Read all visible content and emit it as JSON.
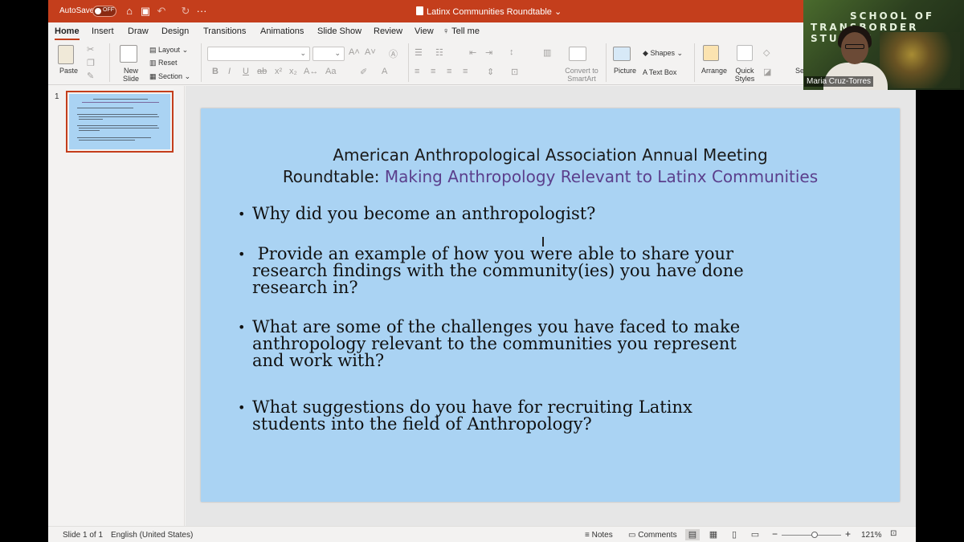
{
  "titlebar": {
    "autosave_label": "AutoSave",
    "autosave_state": "OFF",
    "doc_title": "Latinx Communities Roundtable",
    "title_chevron": "⌄",
    "more": "···"
  },
  "menu": {
    "tabs": [
      "Home",
      "Insert",
      "Draw",
      "Design",
      "Transitions",
      "Animations",
      "Slide Show",
      "Review",
      "View"
    ],
    "tell_me": "Tell me",
    "active": "Home"
  },
  "ribbon": {
    "paste": "Paste",
    "new_slide": "New Slide",
    "layout": "Layout",
    "reset": "Reset",
    "section": "Section",
    "convert_smartart": "Convert to SmartArt",
    "picture": "Picture",
    "shapes": "Shapes",
    "text_box": "Text Box",
    "arrange": "Arrange",
    "quick_styles": "Quick Styles",
    "cut_off": "Se"
  },
  "thumbnails": {
    "slide_number": "1"
  },
  "slide": {
    "title_line1": "American Anthropological Association Annual Meeting",
    "title_line2_prefix": "Roundtable: ",
    "title_line2_accent": "Making Anthropology Relevant to Latinx Communities",
    "bullets": [
      {
        "lines": [
          "Why did you become an anthropologist?"
        ]
      },
      {
        "lines": [
          " Provide an example of how you were able to share your",
          "research findings with the community(ies) you have done",
          "research in?"
        ]
      },
      {
        "lines": [
          "What are some of the challenges you have faced to make",
          "anthropology relevant to the communities you represent",
          "and work with?"
        ]
      },
      {
        "lines": [
          "What suggestions do you have for recruiting Latinx",
          "students into the field of Anthropology?"
        ]
      }
    ]
  },
  "statusbar": {
    "slide_info": "Slide 1 of 1",
    "language": "English (United States)",
    "notes": "Notes",
    "comments": "Comments",
    "zoom_minus": "−",
    "zoom_plus": "+",
    "zoom": "121%"
  },
  "video": {
    "bg_line1": "SCHOOL OF",
    "bg_line2": "TRANSBORDER STUDIES",
    "participant": "Maria Cruz-Torres"
  }
}
